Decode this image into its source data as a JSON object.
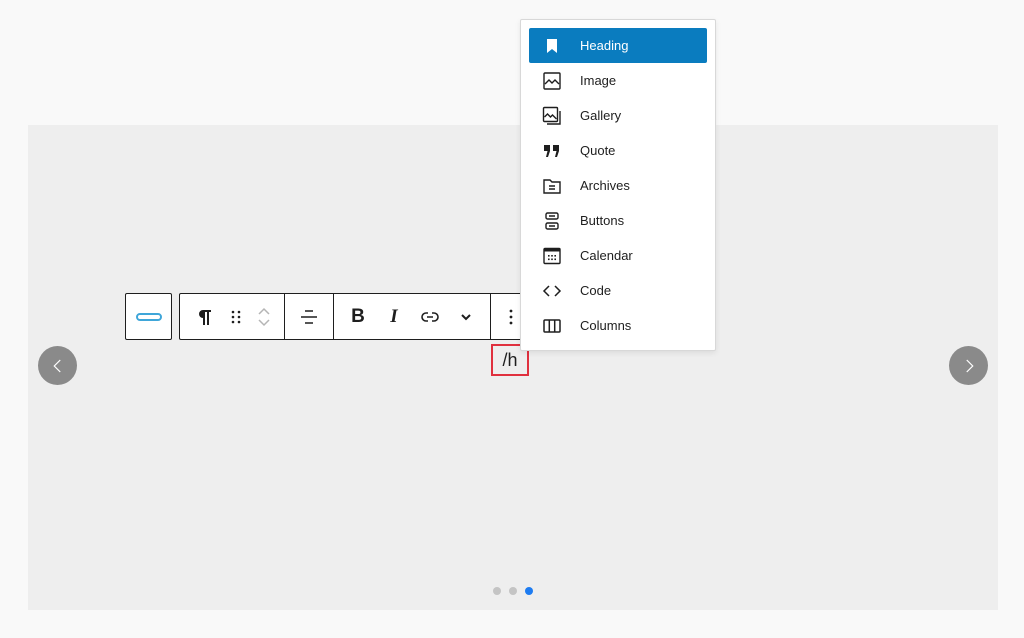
{
  "slider": {
    "prev_label": "Previous slide",
    "next_label": "Next slide",
    "dots": [
      {
        "label": "Slide 1",
        "active": false
      },
      {
        "label": "Slide 2",
        "active": false
      },
      {
        "label": "Slide 3",
        "active": true
      }
    ],
    "active_dot_color": "#1e7cf1"
  },
  "toolbar": {
    "separator_block": "separator-icon",
    "paragraph": "paragraph-icon",
    "drag": "drag-handle-icon",
    "move_up": "chevron-up-icon",
    "move_down": "chevron-down-icon",
    "align": "align-center-icon",
    "bold": "B",
    "italic": "I",
    "link": "link-icon",
    "more_formats": "chevron-down-icon",
    "options": "more-vertical-icon"
  },
  "editor": {
    "slash_text": "/h",
    "highlight_color": "#e0303e"
  },
  "inserter": {
    "accent_color": "#0a7cbf",
    "items": [
      {
        "label": "Heading",
        "icon": "bookmark-icon",
        "selected": true
      },
      {
        "label": "Image",
        "icon": "image-icon",
        "selected": false
      },
      {
        "label": "Gallery",
        "icon": "gallery-icon",
        "selected": false
      },
      {
        "label": "Quote",
        "icon": "quote-icon",
        "selected": false
      },
      {
        "label": "Archives",
        "icon": "archive-icon",
        "selected": false
      },
      {
        "label": "Buttons",
        "icon": "buttons-icon",
        "selected": false
      },
      {
        "label": "Calendar",
        "icon": "calendar-icon",
        "selected": false
      },
      {
        "label": "Code",
        "icon": "code-icon",
        "selected": false
      },
      {
        "label": "Columns",
        "icon": "columns-icon",
        "selected": false
      }
    ]
  }
}
